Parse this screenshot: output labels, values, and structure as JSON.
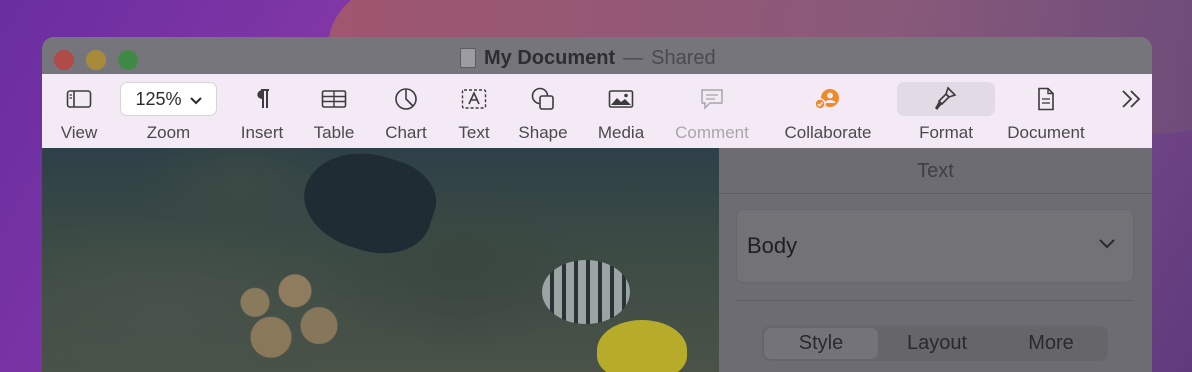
{
  "window": {
    "title": "My Document",
    "title_separator": "—",
    "shared_status": "Shared"
  },
  "toolbar": {
    "items": [
      {
        "label": "View",
        "icon": "sidebar-view-icon",
        "enabled": true
      },
      {
        "label": "Zoom",
        "value": "125%",
        "icon": "chevron-down-icon",
        "enabled": true
      },
      {
        "label": "Insert",
        "icon": "pilcrow-icon",
        "enabled": true
      },
      {
        "label": "Table",
        "icon": "table-icon",
        "enabled": true
      },
      {
        "label": "Chart",
        "icon": "pie-chart-icon",
        "enabled": true
      },
      {
        "label": "Text",
        "icon": "text-box-icon",
        "enabled": true
      },
      {
        "label": "Shape",
        "icon": "shapes-icon",
        "enabled": true
      },
      {
        "label": "Media",
        "icon": "photo-icon",
        "enabled": true
      },
      {
        "label": "Comment",
        "icon": "comment-icon",
        "enabled": false
      },
      {
        "label": "Collaborate",
        "icon": "collaborate-icon",
        "enabled": true
      },
      {
        "label": "Format",
        "icon": "paintbrush-icon",
        "enabled": true,
        "selected": true
      },
      {
        "label": "Document",
        "icon": "document-icon",
        "enabled": true
      }
    ],
    "overflow_icon": "chevrons-right-icon"
  },
  "sidebar": {
    "header": "Text",
    "paragraph_style": "Body",
    "tabs": [
      {
        "label": "Style",
        "active": true
      },
      {
        "label": "Layout",
        "active": false
      },
      {
        "label": "More",
        "active": false
      }
    ]
  },
  "colors": {
    "toolbar_bg": "#f3eaf6",
    "collaborate_accent": "#f08a24",
    "dim_overlay": "#6c6c72"
  }
}
